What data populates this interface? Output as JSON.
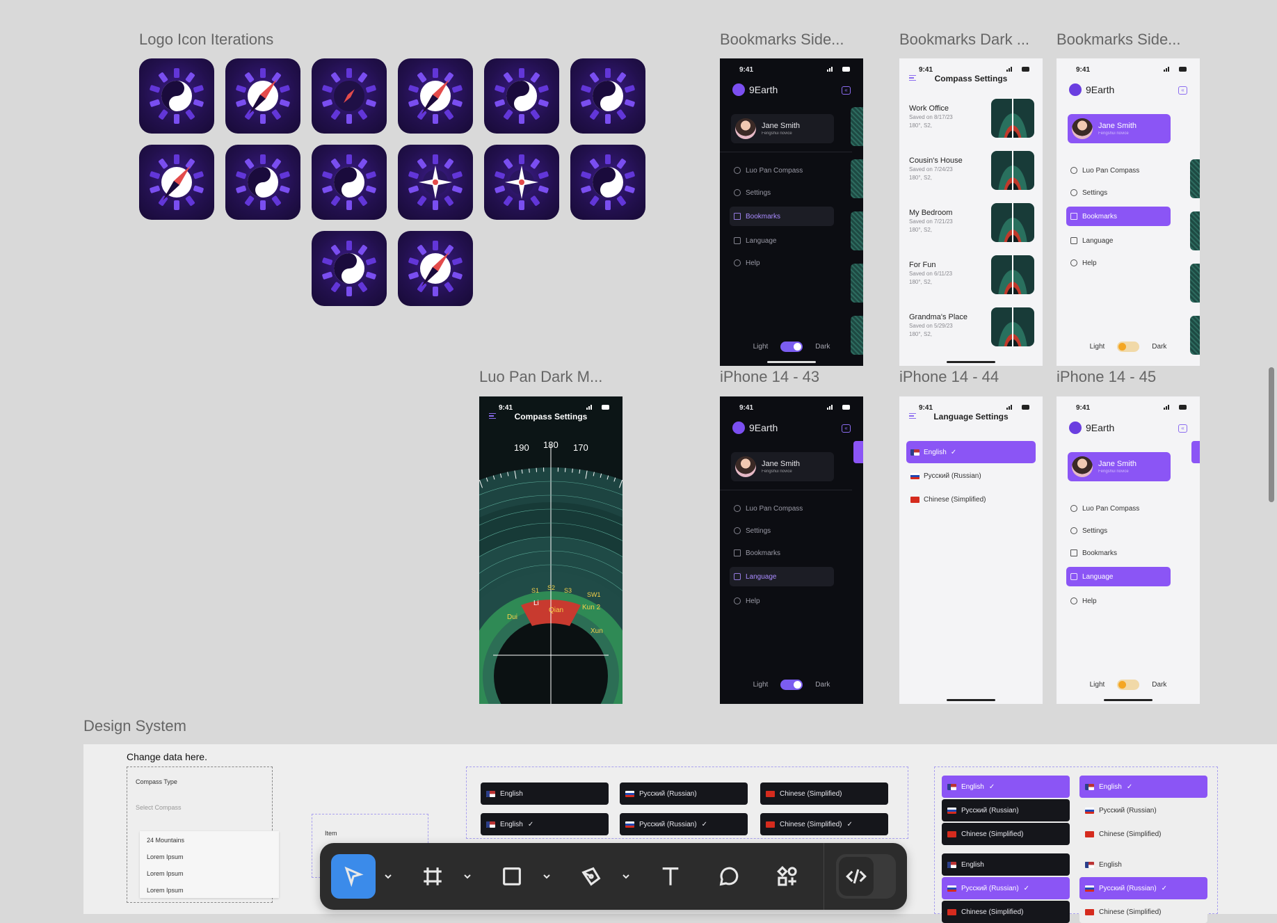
{
  "frames": {
    "logo_iterations": "Logo Icon Iterations",
    "bookmarks_side_dark": "Bookmarks Side...",
    "bookmarks_dark": "Bookmarks Dark ...",
    "bookmarks_side_light": "Bookmarks Side...",
    "luo_pan_dark": "Luo Pan Dark M...",
    "iphone43": "iPhone 14 - 43",
    "iphone44": "iPhone 14 - 44",
    "iphone45": "iPhone 14 - 45",
    "design_system": "Design System"
  },
  "status_time": "9:41",
  "app_name": "9Earth",
  "user": {
    "name": "Jane Smith",
    "subtitle": "Fengshui novice"
  },
  "menu": {
    "compass": "Luo Pan Compass",
    "settings": "Settings",
    "bookmarks": "Bookmarks",
    "language": "Language",
    "help": "Help"
  },
  "theme": {
    "light": "Light",
    "dark": "Dark"
  },
  "bookmarks_screen": {
    "title": "Compass Settings",
    "items": [
      {
        "title": "Work Office",
        "saved": "Saved on 8/17/23",
        "coords": "180°, S2,"
      },
      {
        "title": "Cousin's House",
        "saved": "Saved on 7/24/23",
        "coords": "180°, S2,"
      },
      {
        "title": "My Bedroom",
        "saved": "Saved on 7/21/23",
        "coords": "180°, S2,"
      },
      {
        "title": "For Fun",
        "saved": "Saved on 6/11/23",
        "coords": "180°, S2,"
      },
      {
        "title": "Grandma's Place",
        "saved": "Saved on 5/29/23",
        "coords": "180°, S2,"
      }
    ]
  },
  "compass_screen": {
    "title": "Compass Settings",
    "degrees": [
      "190",
      "180",
      "170"
    ],
    "labels": [
      "Li",
      "Qian",
      "Kun 2",
      "Xun",
      "Dui",
      "S1",
      "S2",
      "S3",
      "SW1"
    ]
  },
  "language_screen": {
    "title": "Language Settings",
    "options": [
      "English",
      "Русский (Russian)",
      "Chinese (Simplified)"
    ],
    "check": "✓"
  },
  "design_system": {
    "change_note": "Change data here.",
    "compass_type": "Compass Type",
    "select_compass": "Select Compass",
    "options": [
      "24 Mountains",
      "Lorem Ipsum",
      "Lorem Ipsum",
      "Lorem Ipsum"
    ],
    "item": "Item"
  },
  "toolbar": {
    "tools": [
      "move-tool",
      "frame-tool",
      "shape-tool",
      "pen-tool",
      "text-tool",
      "comment-tool",
      "assets-tool",
      "dev-mode-toggle"
    ]
  },
  "colors": {
    "accent": "#8b55f5",
    "dark_bg": "#0c0d12",
    "canvas": "#d9d9d9",
    "toolbar": "#2c2c2c",
    "tool_active": "#3b8bea"
  }
}
